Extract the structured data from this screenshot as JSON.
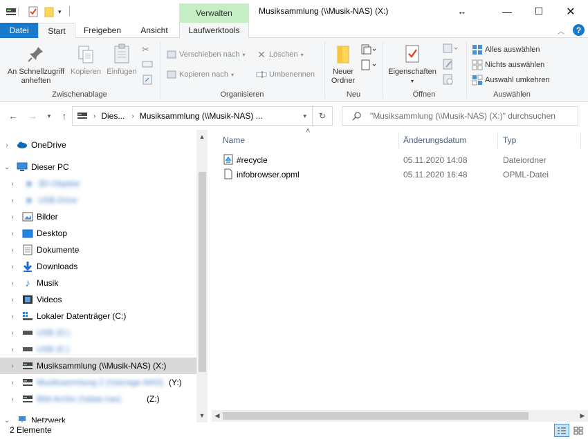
{
  "window": {
    "title": "Musiksammlung (\\\\Musik-NAS) (X:)",
    "context_header": "Verwalten",
    "minimize_glyph": "—",
    "maximize_glyph": "☐",
    "close_glyph": "✕",
    "resize_glyph": "↔"
  },
  "tabs": {
    "file": "Datei",
    "start": "Start",
    "share": "Freigeben",
    "view": "Ansicht",
    "drive_tools": "Laufwerktools"
  },
  "ribbon": {
    "clipboard": {
      "group": "Zwischenablage",
      "pin_line1": "An Schnellzugriff",
      "pin_line2": "anheften",
      "copy": "Kopieren",
      "paste": "Einfügen"
    },
    "organize": {
      "group": "Organisieren",
      "move_to": "Verschieben nach",
      "copy_to": "Kopieren nach",
      "delete": "Löschen",
      "rename": "Umbenennen"
    },
    "new": {
      "group": "Neu",
      "new_folder_line1": "Neuer",
      "new_folder_line2": "Ordner"
    },
    "open": {
      "group": "Öffnen",
      "properties": "Eigenschaften"
    },
    "select": {
      "group": "Auswählen",
      "select_all": "Alles auswählen",
      "select_none": "Nichts auswählen",
      "invert": "Auswahl umkehren"
    }
  },
  "address": {
    "crumb1": "Dies...",
    "crumb2": "Musiksammlung (\\\\Musik-NAS) ...",
    "search_placeholder": "\"Musiksammlung (\\\\Musik-NAS) (X:)\" durchsuchen"
  },
  "tree": {
    "onedrive": "OneDrive",
    "this_pc": "Dieser PC",
    "blur1": "3D-Objekte",
    "blur2": "USB-Drive",
    "pictures": "Bilder",
    "desktop": "Desktop",
    "documents": "Dokumente",
    "downloads": "Downloads",
    "music": "Musik",
    "videos": "Videos",
    "local_disk": "Lokaler Datenträger (C:)",
    "blur3": "USB (D:)",
    "blur4": "USB (E:)",
    "music_nas": "Musiksammlung (\\\\Musik-NAS) (X:)",
    "blur5": "Musiksammlung 2 (\\\\storage-NAS)",
    "blur5_suffix": "(Y:)",
    "blur6": "Bild-Archiv (\\\\data-nas)",
    "blur6_suffix": "(Z:)",
    "network": "Netzwerk"
  },
  "columns": {
    "name": "Name",
    "date": "Änderungsdatum",
    "type": "Typ"
  },
  "files": [
    {
      "name": "#recycle",
      "date": "05.11.2020 14:08",
      "type": "Dateiordner"
    },
    {
      "name": "infobrowser.opml",
      "date": "05.11.2020 16:48",
      "type": "OPML-Datei"
    }
  ],
  "status": {
    "count": "2 Elemente"
  },
  "icons": {
    "help": "?",
    "sort_up": "˄"
  },
  "colors": {
    "accent": "#1979ca",
    "context_tab": "#c5eec5",
    "selection": "#d9d9d9"
  }
}
